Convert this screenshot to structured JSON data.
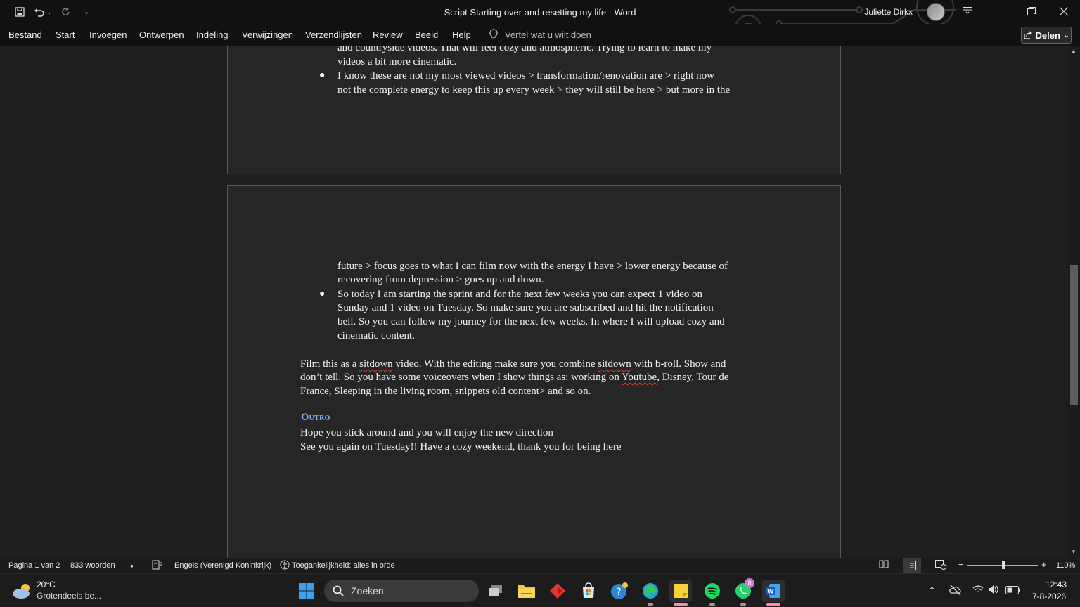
{
  "window": {
    "title": "Script Starting over and resetting my life  -  Word",
    "user_name": "Juliette Dirkx"
  },
  "ribbon": {
    "tabs": [
      "Bestand",
      "Start",
      "Invoegen",
      "Ontwerpen",
      "Indeling",
      "Verwijzingen",
      "Verzendlijsten",
      "Review",
      "Beeld",
      "Help"
    ],
    "tell_me": "Vertel wat u wilt doen",
    "share_label": "Delen"
  },
  "document": {
    "page1": {
      "bullet1_line1": "and countryside videos. That will feel cozy and atmospheric. Trying to learn to make my",
      "bullet1_line2": "videos a bit more cinematic.",
      "bullet2_line1": "I know these are not my most viewed videos > transformation/renovation are > right now",
      "bullet2_line2": "not the complete energy to keep this up every week > they will still be here > but more in the"
    },
    "page2": {
      "cont_line1": "future > focus goes to what I can film now with the energy I have  > lower energy because of",
      "cont_line2": "recovering from depression > goes up and down.",
      "bullet3_line1": "So today I am starting the sprint and for the next few weeks you can expect 1 video on",
      "bullet3_line2": "Sunday and 1 video on Tuesday. So make sure you are subscribed and hit the notification",
      "bullet3_line3": "bell. So you can follow my journey for the next few weeks. In where I will upload cozy and",
      "bullet3_line4": "cinematic content.",
      "para_l1_a": "Film this as a ",
      "para_l1_b": "sitdown",
      "para_l1_c": " video. With the editing make sure you combine ",
      "para_l1_d": "sitdown",
      "para_l1_e": " with b-roll. Show and",
      "para_l2_a": "don’t tell. So you have some voiceovers when I show things as: working on ",
      "para_l2_b": "Youtube",
      "para_l2_c": ", Disney, Tour de",
      "para_l3": "France, Sleeping in the living room, snippets old content> and so on.",
      "outro_heading": "Outro",
      "outro_line1": "Hope you stick around and you will enjoy the new direction",
      "outro_line2": "See you again on Tuesday!! Have a cozy weekend, thank you for being here"
    }
  },
  "statusbar": {
    "page": "Pagina 1 van 2",
    "words": "833 woorden",
    "language": "Engels (Verenigd Koninkrijk)",
    "accessibility": "Toegankelijkheid: alles in orde",
    "zoom": "110%"
  },
  "taskbar": {
    "weather_temp": "20°C",
    "weather_desc": "Grotendeels be...",
    "search_placeholder": "Zoeken",
    "whatsapp_badge": "8",
    "time": "12:43",
    "date": "7-8-2026"
  },
  "colors": {
    "heading_accent": "#8ab4f8",
    "spell_error": "#e53935"
  }
}
